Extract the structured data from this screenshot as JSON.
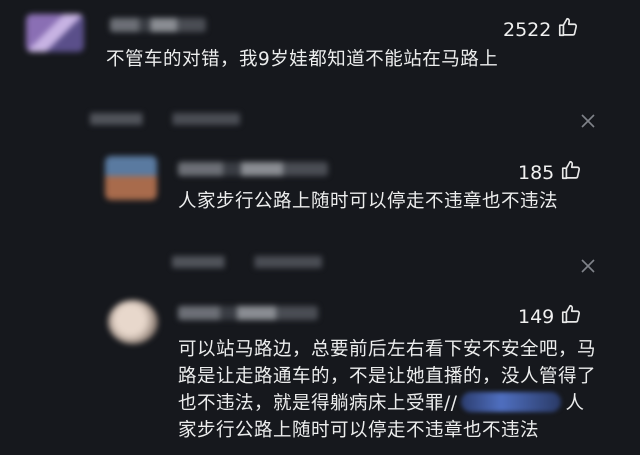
{
  "comments": [
    {
      "likes": "2522",
      "text": "不管车的对错，我9岁娃都知道不能站在马路上",
      "avatar_colors": [
        "#7b67a6",
        "#a58fc9"
      ]
    },
    {
      "likes": "185",
      "text": "人家步行公路上随时可以停走不违章也不违法",
      "avatar_colors": [
        "#4d6a8c",
        "#b07a5a"
      ]
    },
    {
      "likes": "149",
      "text_part1": "可以站马路边，总要前后左右看下安不安全吧，马路是让走路通车的，不是让她直播的，没人管得了也不违法，就是得躺病床上受罪//",
      "text_part2": "人家步行公路上随时可以停走不违章也不违法",
      "avatar_colors": [
        "#d9c7bb",
        "#9e8f86"
      ]
    }
  ],
  "icons": {
    "like": "thumbs-up-icon",
    "close": "close-icon"
  },
  "colors": {
    "background": "#16181d",
    "text": "#eceded",
    "muted": "#7d8088"
  }
}
